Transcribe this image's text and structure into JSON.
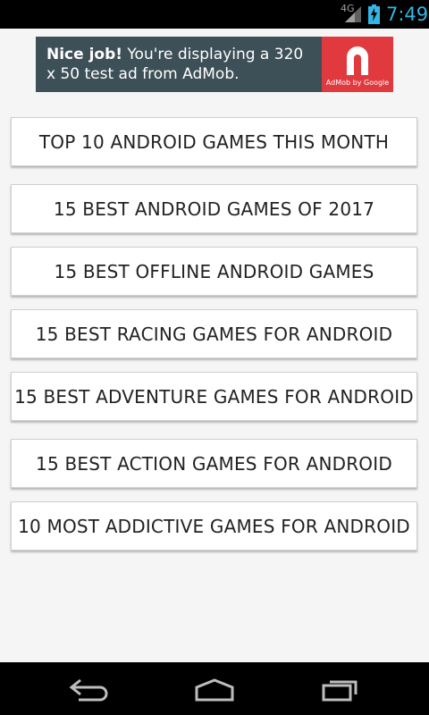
{
  "status_bar": {
    "network": "4G",
    "time": "7:49",
    "time_color": "#33b5e5"
  },
  "ad": {
    "headline": "Nice job!",
    "body": "You're displaying a 320 x 50 test ad from AdMob.",
    "logo_caption": "AdMob by Google",
    "background_color": "#3d4f57",
    "logo_color": "#e0393e"
  },
  "menu": {
    "items": [
      {
        "label": "TOP 10 ANDROID GAMES THIS MONTH"
      },
      {
        "label": "15 BEST ANDROID GAMES OF 2017"
      },
      {
        "label": "15 BEST OFFLINE ANDROID GAMES"
      },
      {
        "label": "15 BEST RACING GAMES FOR ANDROID"
      },
      {
        "label": "15 BEST ADVENTURE GAMES FOR ANDROID"
      },
      {
        "label": "15 BEST ACTION GAMES FOR ANDROID"
      },
      {
        "label": "10 MOST ADDICTIVE GAMES FOR ANDROID"
      }
    ]
  },
  "nav_bar": {
    "icons": [
      "back-icon",
      "home-icon",
      "recent-apps-icon"
    ]
  }
}
